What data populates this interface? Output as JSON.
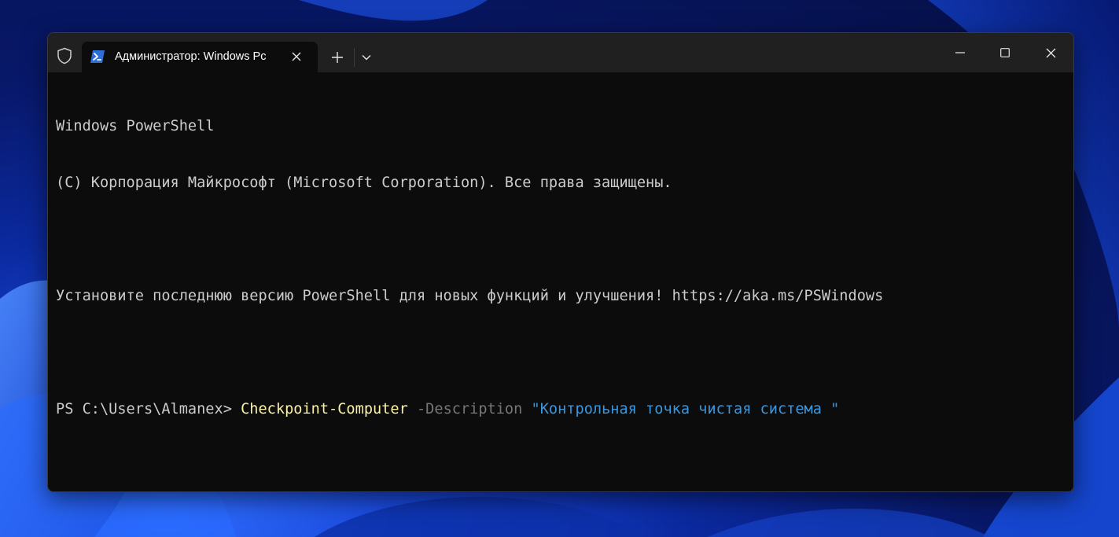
{
  "window": {
    "tab_title": "Администратор: Windows Pc"
  },
  "icons": {
    "shield": "shield-icon",
    "powershell": "powershell-icon",
    "tab_close": "close-icon",
    "new_tab": "plus-icon",
    "dropdown": "chevron-down-icon",
    "minimize": "minimize-icon",
    "maximize": "maximize-icon",
    "close": "close-icon"
  },
  "terminal": {
    "line1": "Windows PowerShell",
    "line2": "(C) Корпорация Майкрософт (Microsoft Corporation). Все права защищены.",
    "line3": "Установите последнюю версию PowerShell для новых функций и улучшения! https://aka.ms/PSWindows",
    "prompt": "PS C:\\Users\\Almanex> ",
    "command": "Checkpoint-Computer",
    "parameter": " -Description",
    "argument": " \"Контрольная точка чистая система \""
  },
  "colors": {
    "background": "#0c0c0c",
    "text": "#cccccc",
    "command": "#f9f1a5",
    "parameter": "#767676",
    "string": "#3a96dd",
    "titlebar": "#202020"
  }
}
